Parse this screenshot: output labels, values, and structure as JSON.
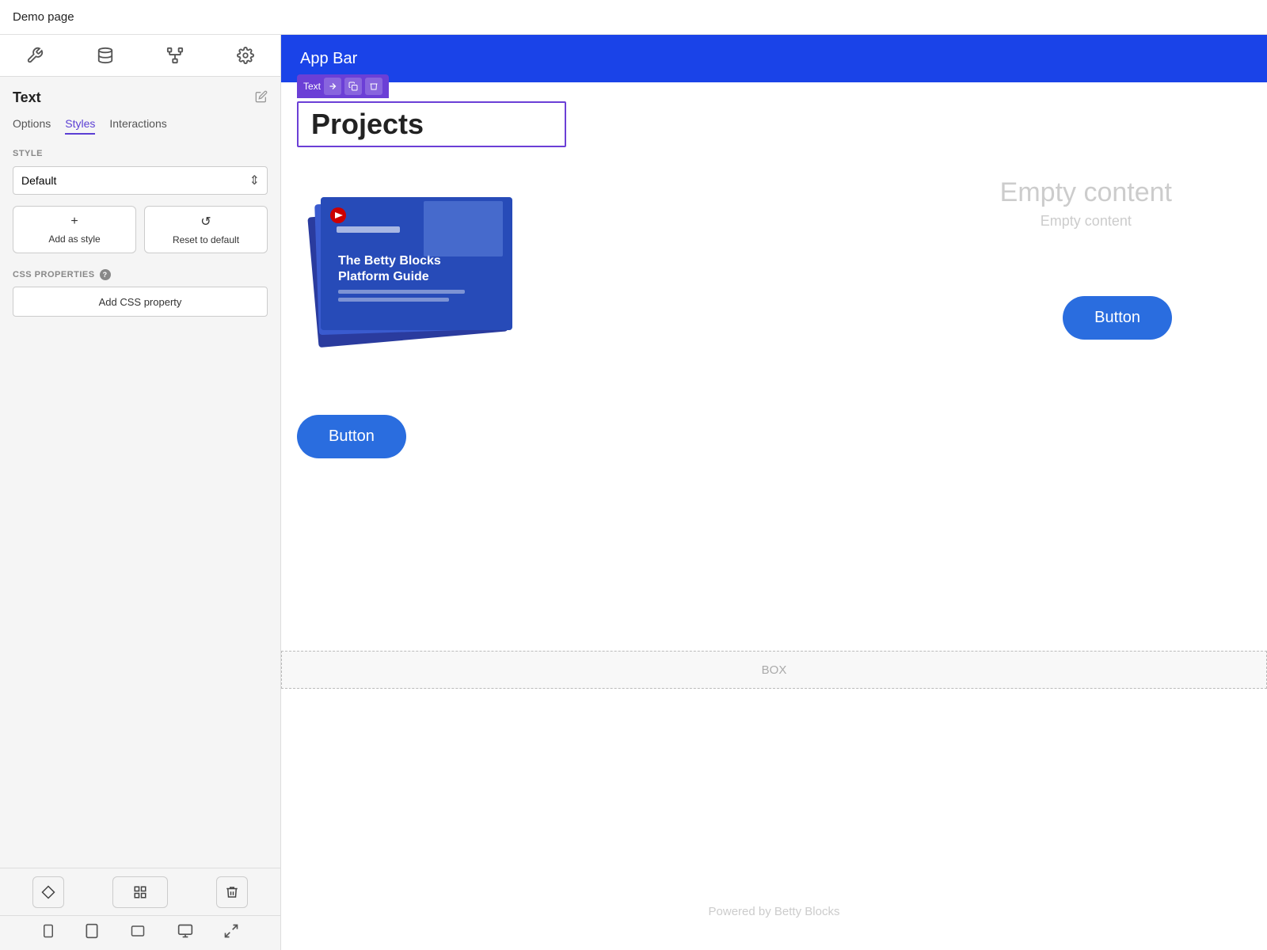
{
  "topbar": {
    "title": "Demo page"
  },
  "sidebar": {
    "tabs": [
      {
        "icon": "✂",
        "label": "components-icon"
      },
      {
        "icon": "⬡",
        "label": "data-icon"
      },
      {
        "icon": "⚙",
        "label": "structure-icon"
      },
      {
        "icon": "⚙",
        "label": "settings-icon"
      }
    ],
    "title": "Text",
    "subtabs": [
      {
        "label": "Options",
        "active": false
      },
      {
        "label": "Styles",
        "active": true
      },
      {
        "label": "Interactions",
        "active": false
      }
    ],
    "style_section_label": "STYLE",
    "style_default_value": "Default",
    "actions": [
      {
        "label": "Add as style",
        "icon": "+"
      },
      {
        "label": "Reset to default",
        "icon": "↺"
      }
    ],
    "css_section_label": "CSS PROPERTIES",
    "add_css_label": "Add CSS property"
  },
  "bottom_bar": {
    "icons": [
      "◆",
      "⊞",
      "🗑"
    ]
  },
  "device_bar": {
    "devices": [
      "📱",
      "⬛",
      "🖥",
      "🖥",
      "⤢"
    ]
  },
  "canvas": {
    "app_bar_label": "App Bar",
    "text_badge": "Text",
    "projects_text": "Projects",
    "empty_content_title": "Empty content",
    "empty_content_sub": "Empty content",
    "button_label": "Button",
    "button_label_2": "Button",
    "box_label": "BOX",
    "footer_text": "Powered by Betty Blocks"
  }
}
